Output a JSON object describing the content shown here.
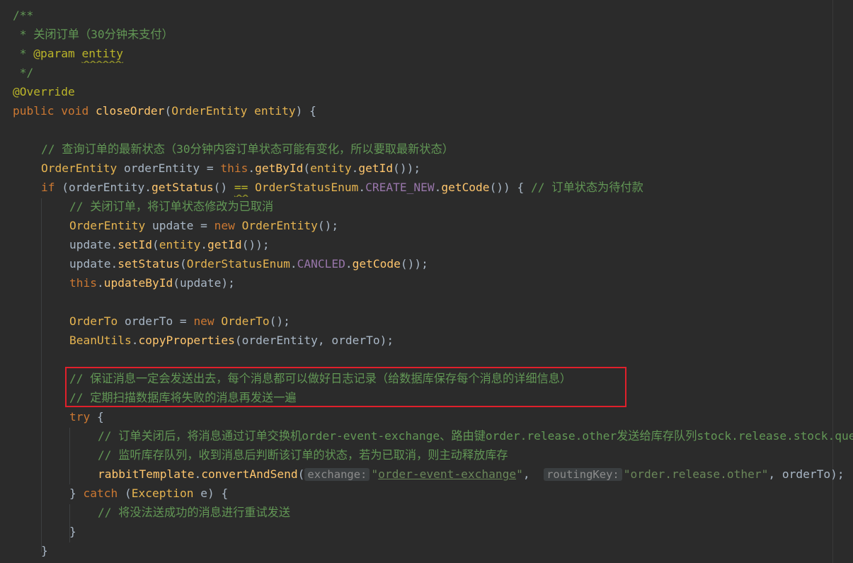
{
  "lines": [
    {
      "indent": 0,
      "tokens": [
        {
          "t": "/**",
          "c": "c-doc"
        }
      ]
    },
    {
      "indent": 0,
      "tokens": [
        {
          "t": " * 关闭订单（30分钟未支付）",
          "c": "c-doc"
        }
      ]
    },
    {
      "indent": 0,
      "tokens": [
        {
          "t": " * ",
          "c": "c-doc"
        },
        {
          "t": "@param",
          "c": "c-annot"
        },
        {
          "t": " ",
          "c": "c-doc"
        },
        {
          "t": "entity",
          "c": "c-param"
        }
      ]
    },
    {
      "indent": 0,
      "tokens": [
        {
          "t": " */",
          "c": "c-doc"
        }
      ]
    },
    {
      "indent": 0,
      "tokens": [
        {
          "t": "@Override",
          "c": "c-annot"
        }
      ]
    },
    {
      "indent": 0,
      "tokens": [
        {
          "t": "public ",
          "c": "c-kw"
        },
        {
          "t": "void ",
          "c": "c-kw"
        },
        {
          "t": "closeOrder",
          "c": "c-method"
        },
        {
          "t": "(",
          "c": "c-var"
        },
        {
          "t": "OrderEntity ",
          "c": "c-type"
        },
        {
          "t": "entity",
          "c": "c-type"
        },
        {
          "t": ") {",
          "c": "c-var"
        }
      ]
    },
    {
      "indent": 0,
      "tokens": []
    },
    {
      "indent": 1,
      "tokens": [
        {
          "t": "// 查询订单的最新状态（30分钟内容订单状态可能有变化，所以要取最新状态）",
          "c": "c-comment"
        }
      ]
    },
    {
      "indent": 1,
      "tokens": [
        {
          "t": "OrderEntity ",
          "c": "c-type"
        },
        {
          "t": "orderEntity = ",
          "c": "c-var"
        },
        {
          "t": "this",
          "c": "c-kw"
        },
        {
          "t": ".",
          "c": "c-var"
        },
        {
          "t": "getById",
          "c": "c-method"
        },
        {
          "t": "(",
          "c": "c-var"
        },
        {
          "t": "entity",
          "c": "c-type"
        },
        {
          "t": ".",
          "c": "c-var"
        },
        {
          "t": "getId",
          "c": "c-method"
        },
        {
          "t": "());",
          "c": "c-var"
        }
      ]
    },
    {
      "indent": 1,
      "tokens": [
        {
          "t": "if ",
          "c": "c-kw"
        },
        {
          "t": "(orderEntity.",
          "c": "c-var"
        },
        {
          "t": "getStatus",
          "c": "c-method"
        },
        {
          "t": "() ",
          "c": "c-var"
        },
        {
          "t": "==",
          "c": "c-param"
        },
        {
          "t": " ",
          "c": "c-var"
        },
        {
          "t": "OrderStatusEnum",
          "c": "c-type"
        },
        {
          "t": ".",
          "c": "c-var"
        },
        {
          "t": "CREATE_NEW",
          "c": "c-purple"
        },
        {
          "t": ".",
          "c": "c-var"
        },
        {
          "t": "getCode",
          "c": "c-method"
        },
        {
          "t": "()) { ",
          "c": "c-var"
        },
        {
          "t": "// 订单状态为待付款",
          "c": "c-comment"
        }
      ]
    },
    {
      "indent": 2,
      "tokens": [
        {
          "t": "// 关闭订单，将订单状态修改为已取消",
          "c": "c-comment"
        }
      ]
    },
    {
      "indent": 2,
      "tokens": [
        {
          "t": "OrderEntity ",
          "c": "c-type"
        },
        {
          "t": "update = ",
          "c": "c-var"
        },
        {
          "t": "new ",
          "c": "c-kw"
        },
        {
          "t": "OrderEntity",
          "c": "c-type"
        },
        {
          "t": "();",
          "c": "c-var"
        }
      ]
    },
    {
      "indent": 2,
      "tokens": [
        {
          "t": "update.",
          "c": "c-var"
        },
        {
          "t": "setId",
          "c": "c-method"
        },
        {
          "t": "(",
          "c": "c-var"
        },
        {
          "t": "entity",
          "c": "c-type"
        },
        {
          "t": ".",
          "c": "c-var"
        },
        {
          "t": "getId",
          "c": "c-method"
        },
        {
          "t": "());",
          "c": "c-var"
        }
      ]
    },
    {
      "indent": 2,
      "tokens": [
        {
          "t": "update.",
          "c": "c-var"
        },
        {
          "t": "setStatus",
          "c": "c-method"
        },
        {
          "t": "(",
          "c": "c-var"
        },
        {
          "t": "OrderStatusEnum",
          "c": "c-type"
        },
        {
          "t": ".",
          "c": "c-var"
        },
        {
          "t": "CANCLED",
          "c": "c-purple"
        },
        {
          "t": ".",
          "c": "c-var"
        },
        {
          "t": "getCode",
          "c": "c-method"
        },
        {
          "t": "());",
          "c": "c-var"
        }
      ]
    },
    {
      "indent": 2,
      "tokens": [
        {
          "t": "this",
          "c": "c-kw"
        },
        {
          "t": ".",
          "c": "c-var"
        },
        {
          "t": "updateById",
          "c": "c-method"
        },
        {
          "t": "(update);",
          "c": "c-var"
        }
      ]
    },
    {
      "indent": 0,
      "tokens": []
    },
    {
      "indent": 2,
      "tokens": [
        {
          "t": "OrderTo ",
          "c": "c-type"
        },
        {
          "t": "orderTo = ",
          "c": "c-var"
        },
        {
          "t": "new ",
          "c": "c-kw"
        },
        {
          "t": "OrderTo",
          "c": "c-type"
        },
        {
          "t": "();",
          "c": "c-var"
        }
      ]
    },
    {
      "indent": 2,
      "tokens": [
        {
          "t": "BeanUtils",
          "c": "c-type"
        },
        {
          "t": ".",
          "c": "c-var"
        },
        {
          "t": "copyProperties",
          "c": "c-method"
        },
        {
          "t": "(orderEntity, orderTo);",
          "c": "c-var"
        }
      ]
    },
    {
      "indent": 0,
      "tokens": []
    },
    {
      "indent": 2,
      "tokens": [
        {
          "t": "// 保证消息一定会发送出去，每个消息都可以做好日志记录（给数据库保存每个消息的详细信息）",
          "c": "c-comment"
        }
      ]
    },
    {
      "indent": 2,
      "tokens": [
        {
          "t": "// 定期扫描数据库将失败的消息再发送一遍",
          "c": "c-comment"
        }
      ]
    },
    {
      "indent": 2,
      "tokens": [
        {
          "t": "try ",
          "c": "c-kw"
        },
        {
          "t": "{",
          "c": "c-var"
        }
      ]
    },
    {
      "indent": 3,
      "tokens": [
        {
          "t": "// 订单关闭后，将消息通过订单交换机order-event-exchange、路由键order.release.other发送给库存队列stock.release.stock.queue",
          "c": "c-comment"
        }
      ]
    },
    {
      "indent": 3,
      "tokens": [
        {
          "t": "// 监听库存队列，收到消息后判断该订单的状态，若为已取消，则主动释放库存",
          "c": "c-comment"
        }
      ]
    },
    {
      "indent": 3,
      "tokens": [
        {
          "t": "rabbitTemplate",
          "c": "c-method"
        },
        {
          "t": ".",
          "c": "c-var"
        },
        {
          "t": "convertAndSend",
          "c": "c-method"
        },
        {
          "t": "(",
          "c": "c-var"
        },
        {
          "t": "exchange:",
          "c": "hint"
        },
        {
          "t": "\"",
          "c": "c-string"
        },
        {
          "t": "order-event-exchange",
          "c": "c-url"
        },
        {
          "t": "\"",
          "c": "c-string"
        },
        {
          "t": ",  ",
          "c": "c-var"
        },
        {
          "t": "routingKey:",
          "c": "hint"
        },
        {
          "t": "\"order.release.other\"",
          "c": "c-string"
        },
        {
          "t": ", orderTo);",
          "c": "c-var"
        }
      ]
    },
    {
      "indent": 2,
      "tokens": [
        {
          "t": "} ",
          "c": "c-var"
        },
        {
          "t": "catch ",
          "c": "c-kw"
        },
        {
          "t": "(",
          "c": "c-var"
        },
        {
          "t": "Exception ",
          "c": "c-type"
        },
        {
          "t": "e) {",
          "c": "c-var"
        }
      ]
    },
    {
      "indent": 3,
      "tokens": [
        {
          "t": "// 将没法送成功的消息进行重试发送",
          "c": "c-comment"
        }
      ]
    },
    {
      "indent": 2,
      "tokens": [
        {
          "t": "}",
          "c": "c-var"
        }
      ]
    },
    {
      "indent": 1,
      "tokens": [
        {
          "t": "}",
          "c": "c-var"
        }
      ]
    }
  ]
}
